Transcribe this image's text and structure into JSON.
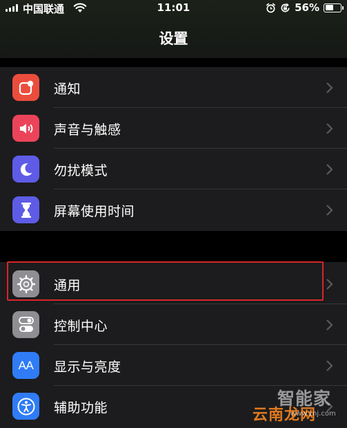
{
  "status_bar": {
    "carrier": "中国联通",
    "time": "11:01",
    "battery_percent": "56%",
    "battery_level": 0.56
  },
  "header": {
    "title": "设置"
  },
  "groups": [
    {
      "items": [
        {
          "label": "通知",
          "icon": "notifications-icon",
          "color": "#eb4d3d"
        },
        {
          "label": "声音与触感",
          "icon": "sounds-icon",
          "color": "#eb445a"
        },
        {
          "label": "勿扰模式",
          "icon": "moon-icon",
          "color": "#5e5ce6"
        },
        {
          "label": "屏幕使用时间",
          "icon": "hourglass-icon",
          "color": "#5e5ce6"
        }
      ]
    },
    {
      "items": [
        {
          "label": "通用",
          "icon": "gear-icon",
          "color": "#8e8e93",
          "highlighted": true
        },
        {
          "label": "控制中心",
          "icon": "toggles-icon",
          "color": "#8e8e93"
        },
        {
          "label": "显示与亮度",
          "icon": "text-size-icon",
          "color": "#2f7cf6",
          "icon_text": "AA"
        },
        {
          "label": "辅助功能",
          "icon": "accessibility-icon",
          "color": "#2f7cf6"
        }
      ]
    }
  ],
  "watermark": {
    "line1": "智能家",
    "line2": "云南龙网",
    "url": "www.znj.com"
  },
  "colors": {
    "background": "#000000",
    "cell": "#1c1c1e",
    "separator": "#38383a",
    "highlight_border": "#d8262a"
  }
}
